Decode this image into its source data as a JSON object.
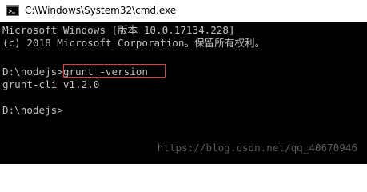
{
  "window": {
    "title": "C:\\Windows\\System32\\cmd.exe"
  },
  "console": {
    "lines": [
      "Microsoft Windows [版本 10.0.17134.228]",
      "(c) 2018 Microsoft Corporation。保留所有权利。",
      "",
      "D:\\nodejs>grunt -version",
      "grunt-cli v1.2.0",
      "",
      "D:\\nodejs>"
    ]
  },
  "watermark": "https://blog.csdn.net/qq_40670946",
  "colors": {
    "console_bg": "#000000",
    "console_text": "#c0c0c0",
    "titlebar_bg": "#ffffff",
    "highlight_border": "#e23c3c"
  },
  "icons": {
    "window_icon": "cmd-icon"
  }
}
